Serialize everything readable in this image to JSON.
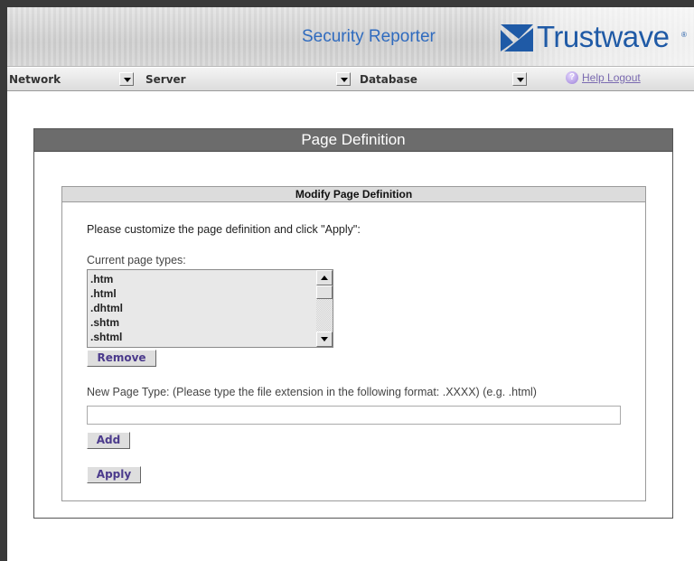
{
  "header": {
    "product_name": "Security Reporter",
    "logo_text": "Trustwave",
    "logo_reg": "®",
    "accent_color": "#2f6bbf"
  },
  "navbar": {
    "items": [
      {
        "label": "Network"
      },
      {
        "label": "Server"
      },
      {
        "label": "Database"
      }
    ],
    "help_label": "Help",
    "logout_label": "Logout"
  },
  "page": {
    "title": "Page Definition"
  },
  "modify": {
    "title": "Modify Page Definition",
    "instruction": "Please customize the page definition and click \"Apply\":",
    "list_label": "Current page types:",
    "page_types": [
      ".htm",
      ".html",
      ".dhtml",
      ".shtm",
      ".shtml"
    ],
    "remove_label": "Remove",
    "new_type_label": "New Page Type: (Please type the file extension in the following format: .XXXX) (e.g. .html)",
    "new_type_value": "",
    "add_label": "Add",
    "apply_label": "Apply"
  }
}
